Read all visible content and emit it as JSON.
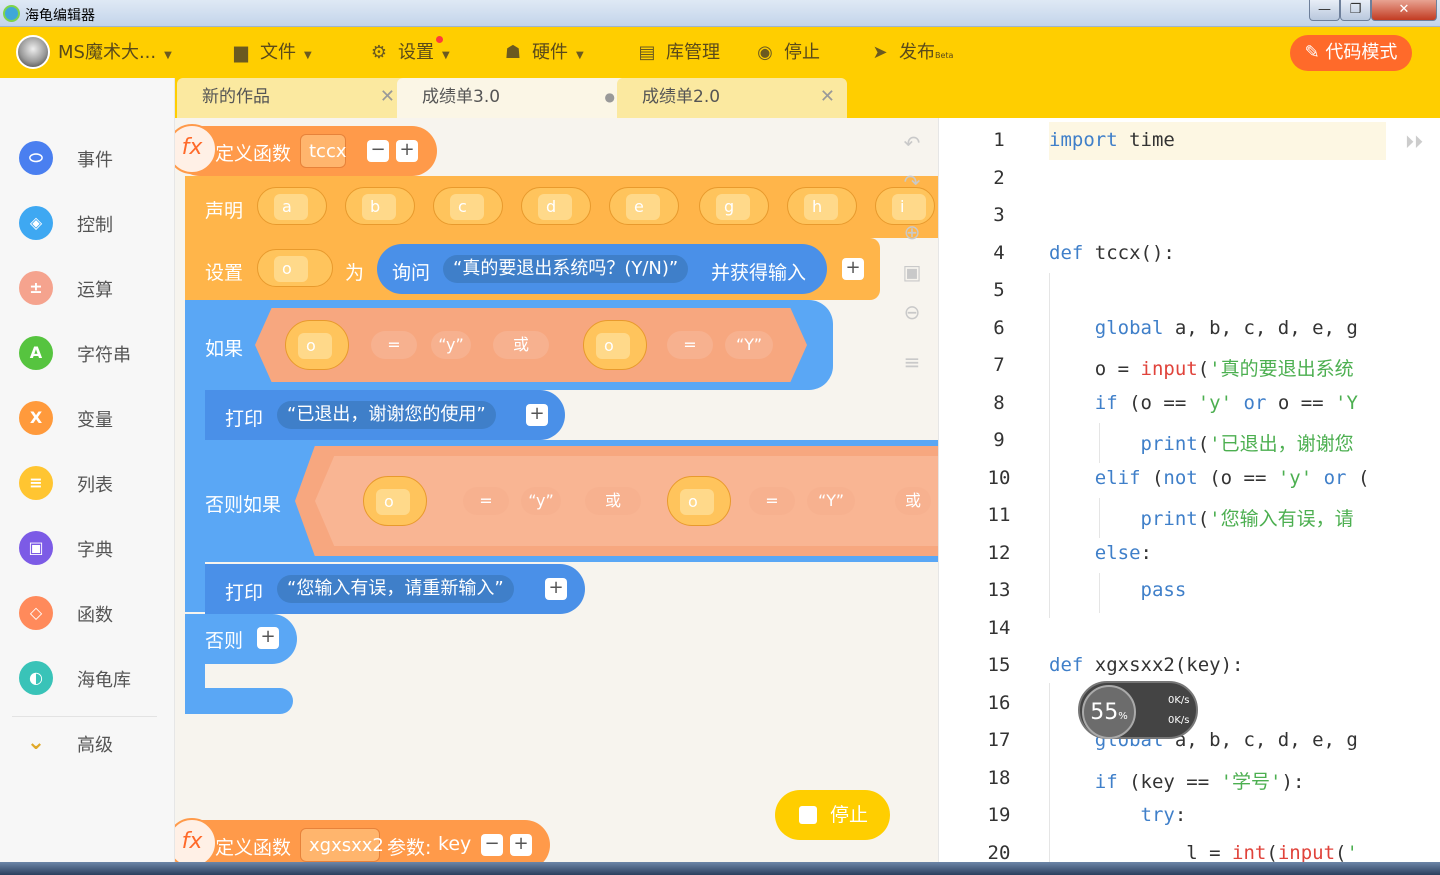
{
  "window": {
    "title": "海龟编辑器",
    "min": "—",
    "max": "❐",
    "close": "✕"
  },
  "toolbar": {
    "user": "MS魔术大...",
    "file": "文件",
    "settings": "设置",
    "hardware": "硬件",
    "library": "库管理",
    "stop": "停止",
    "publish": "发布",
    "beta": "Beta",
    "code_mode": "代码模式"
  },
  "sidebar": {
    "items": [
      {
        "label": "事件",
        "color": "#4a7ff0",
        "icon": "⬭"
      },
      {
        "label": "控制",
        "color": "#3ea8f2",
        "icon": "◈"
      },
      {
        "label": "运算",
        "color": "#f5a38e",
        "icon": "±"
      },
      {
        "label": "字符串",
        "color": "#56c43f",
        "icon": "A"
      },
      {
        "label": "变量",
        "color": "#ff9a3c",
        "icon": "X"
      },
      {
        "label": "列表",
        "color": "#ffc531",
        "icon": "≡"
      },
      {
        "label": "字典",
        "color": "#7c5be6",
        "icon": "▣"
      },
      {
        "label": "函数",
        "color": "#ff8a5b",
        "icon": "◇"
      },
      {
        "label": "海龟库",
        "color": "#39c3b8",
        "icon": "◐"
      },
      {
        "label": "高级",
        "color": "#e0a92a",
        "icon": "⌄"
      }
    ]
  },
  "tabs": [
    {
      "label": "新的作品",
      "close": "✕"
    },
    {
      "label": "成绩单3.0",
      "close": "●"
    },
    {
      "label": "成绩单2.0",
      "close": "✕"
    }
  ],
  "blocks": {
    "def1": {
      "kw": "定义函数",
      "name": "tccx"
    },
    "declare": {
      "kw": "声明",
      "vars": [
        "a",
        "b",
        "c",
        "d",
        "e",
        "g",
        "h",
        "i"
      ]
    },
    "setvar": {
      "kw": "设置",
      "var": "o",
      "as": "为",
      "ask": "询问",
      "prompt": "“真的要退出系统吗？(Y/N)”",
      "suffix": "并获得输入"
    },
    "if": {
      "kw": "如果",
      "var": "o",
      "op": "=",
      "lit1": "“y”",
      "or": "或",
      "lit2": "“Y”"
    },
    "print1": {
      "kw": "打印",
      "text": "“已退出，谢谢您的使用”"
    },
    "elif": {
      "kw": "否则如果",
      "var": "o",
      "op": "=",
      "lit1": "“y”",
      "or": "或",
      "lit2": "“Y”",
      "more": "或"
    },
    "print2": {
      "kw": "打印",
      "text": "“您输入有误，请重新输入”"
    },
    "else": {
      "kw": "否则"
    },
    "def2": {
      "kw": "定义函数",
      "name": "xgxsxx2",
      "param_kw": "参数:",
      "param": "key"
    },
    "fx": "fx"
  },
  "stop_button": "停止",
  "net_widget": {
    "percent": "55",
    "unit": "%",
    "up": "0K/s",
    "down": "0K/s"
  },
  "code": {
    "lines": [
      "1",
      "2",
      "3",
      "4",
      "5",
      "6",
      "7",
      "8",
      "9",
      "10",
      "11",
      "12",
      "13",
      "14",
      "15",
      "16",
      "17",
      "18",
      "19",
      "20"
    ]
  }
}
